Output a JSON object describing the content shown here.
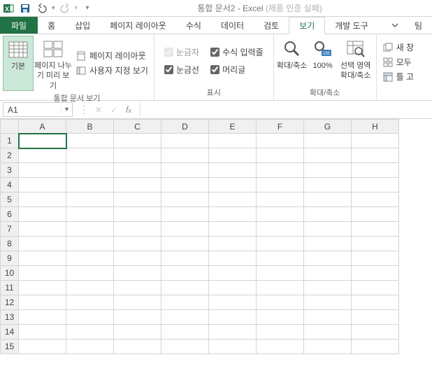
{
  "title": {
    "doc": "통합 문서2 - Excel",
    "suffix": "(제품 인증 실패)"
  },
  "tabs": {
    "file": "파일",
    "items": [
      "홈",
      "삽입",
      "페이지 레이아웃",
      "수식",
      "데이터",
      "검토",
      "보기",
      "개발 도구",
      "팀"
    ],
    "active_index": 6
  },
  "ribbon": {
    "views": {
      "normal": "기본",
      "page_break": "페이지 나누기 미리 보기",
      "page_layout": "페이지 레이아웃",
      "custom_views": "사용자 지정 보기",
      "group_label": "통합 문서 보기"
    },
    "show": {
      "ruler": "눈금자",
      "formula_bar": "수식 입력줄",
      "gridlines": "눈금선",
      "headings": "머리글",
      "group_label": "표시",
      "ruler_checked": true,
      "formula_bar_checked": true,
      "gridlines_checked": true,
      "headings_checked": true
    },
    "zoom": {
      "zoom": "확대/축소",
      "hundred": "100%",
      "selection_top": "선택 영역",
      "selection_bottom": "확대/축소",
      "group_label": "확대/축소"
    },
    "window": {
      "new_window": "새 창",
      "arrange": "모두",
      "freeze": "틀 고"
    }
  },
  "namebox": "A1",
  "columns": [
    "A",
    "B",
    "C",
    "D",
    "E",
    "F",
    "G",
    "H"
  ],
  "rows": [
    "1",
    "2",
    "3",
    "4",
    "5",
    "6",
    "7",
    "8",
    "9",
    "10",
    "11",
    "12",
    "13",
    "14",
    "15"
  ]
}
